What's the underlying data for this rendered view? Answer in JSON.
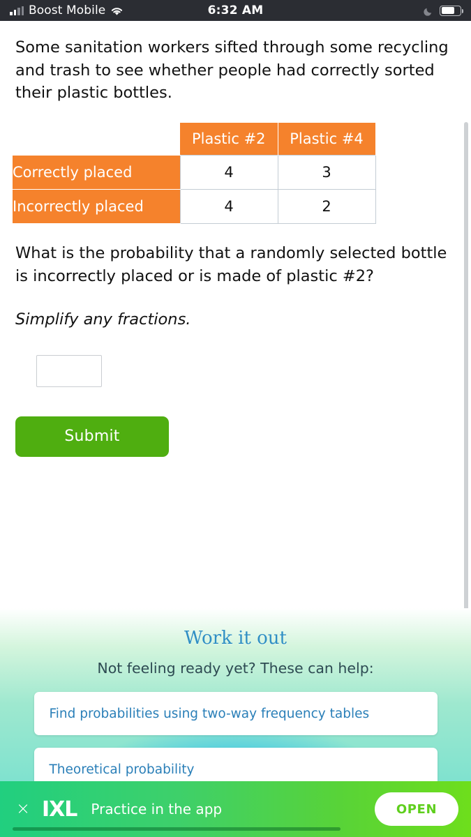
{
  "status_bar": {
    "carrier": "Boost Mobile",
    "time": "6:32 AM",
    "signal_icon": "cellular-bars-icon",
    "wifi_icon": "wifi-icon",
    "dnd_icon": "moon-icon",
    "battery_icon": "battery-icon",
    "battery_level_percent": 70
  },
  "question": {
    "prompt": "Some sanitation workers sifted through some recycling and trash to see whether people had correctly sorted their plastic bottles.",
    "ask": "What is the probability that a randomly selected bottle is incorrectly placed or is made of plastic #2?",
    "hint": "Simplify any fractions.",
    "answer_value": "",
    "answer_placeholder": ""
  },
  "chart_data": {
    "type": "table",
    "title": "",
    "columns": [
      "",
      "Plastic #2",
      "Plastic #4"
    ],
    "rows": [
      {
        "label": "Correctly placed",
        "values": [
          4,
          3
        ]
      },
      {
        "label": "Incorrectly placed",
        "values": [
          4,
          2
        ]
      }
    ],
    "header_color": "#f5822c",
    "header_text_color": "#ffffff",
    "cell_border_color": "#c3ccd4"
  },
  "actions": {
    "submit_label": "Submit",
    "submit_color": "#4fae10"
  },
  "work_it_out": {
    "title": "Work it out",
    "subtitle": "Not feeling ready yet? These can help:",
    "skills": [
      "Find probabilities using two-way frequency tables",
      "Theoretical probability"
    ],
    "link_color": "#2a7fb8",
    "title_color": "#2f8fc4"
  },
  "app_banner": {
    "close_label": "×",
    "logo": "IXL",
    "message": "Practice in the app",
    "open_label": "OPEN"
  }
}
